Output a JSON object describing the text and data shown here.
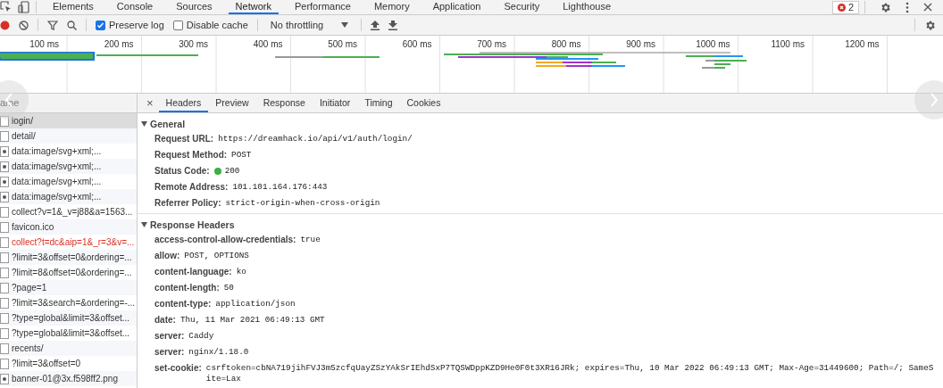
{
  "top_tabs": [
    {
      "label": "Elements",
      "selected": false
    },
    {
      "label": "Console",
      "selected": false
    },
    {
      "label": "Sources",
      "selected": false
    },
    {
      "label": "Network",
      "selected": true
    },
    {
      "label": "Performance",
      "selected": false
    },
    {
      "label": "Memory",
      "selected": false
    },
    {
      "label": "Application",
      "selected": false
    },
    {
      "label": "Security",
      "selected": false
    },
    {
      "label": "Lighthouse",
      "selected": false
    }
  ],
  "error_badge": "2",
  "toolbar": {
    "recording": true,
    "preserve_log": {
      "label": "Preserve log",
      "checked": true
    },
    "disable_cache": {
      "label": "Disable cache",
      "checked": false
    },
    "throttling": "No throttling"
  },
  "timeline": {
    "ticks": [
      "100 ms",
      "200 ms",
      "300 ms",
      "400 ms",
      "500 ms",
      "600 ms",
      "700 ms",
      "800 ms",
      "900 ms",
      "1000 ms",
      "1100 ms",
      "1200 ms"
    ]
  },
  "requests": {
    "column": "ame",
    "rows": [
      {
        "name": "login/",
        "selected": true,
        "error": false,
        "kind": "document"
      },
      {
        "name": "detail/",
        "selected": false,
        "error": false,
        "kind": "document"
      },
      {
        "name": "data:image/svg+xml;...",
        "selected": false,
        "error": false,
        "kind": "image"
      },
      {
        "name": "data:image/svg+xml;...",
        "selected": false,
        "error": false,
        "kind": "image"
      },
      {
        "name": "data:image/svg+xml;...",
        "selected": false,
        "error": false,
        "kind": "image"
      },
      {
        "name": "data:image/svg+xml;...",
        "selected": false,
        "error": false,
        "kind": "image"
      },
      {
        "name": "collect?v=1&_v=j88&a=1563...",
        "selected": false,
        "error": false,
        "kind": "document"
      },
      {
        "name": "favicon.ico",
        "selected": false,
        "error": false,
        "kind": "document"
      },
      {
        "name": "collect?t=dc&aip=1&_r=3&v=...",
        "selected": false,
        "error": true,
        "kind": "document"
      },
      {
        "name": "?limit=3&offset=0&ordering=...",
        "selected": false,
        "error": false,
        "kind": "document"
      },
      {
        "name": "?limit=8&offset=0&ordering=...",
        "selected": false,
        "error": false,
        "kind": "document"
      },
      {
        "name": "?page=1",
        "selected": false,
        "error": false,
        "kind": "document"
      },
      {
        "name": "?limit=3&search=&ordering=-...",
        "selected": false,
        "error": false,
        "kind": "document"
      },
      {
        "name": "?type=global&limit=3&offset...",
        "selected": false,
        "error": false,
        "kind": "document"
      },
      {
        "name": "?type=global&limit=3&offset...",
        "selected": false,
        "error": false,
        "kind": "document"
      },
      {
        "name": "recents/",
        "selected": false,
        "error": false,
        "kind": "document"
      },
      {
        "name": "?limit=3&offset=0",
        "selected": false,
        "error": false,
        "kind": "document"
      },
      {
        "name": "banner-01@3x.f598ff2.png",
        "selected": false,
        "error": false,
        "kind": "image"
      }
    ]
  },
  "close_symbol": "×",
  "detail_tabs": [
    {
      "label": "Headers",
      "selected": true
    },
    {
      "label": "Preview",
      "selected": false
    },
    {
      "label": "Response",
      "selected": false
    },
    {
      "label": "Initiator",
      "selected": false
    },
    {
      "label": "Timing",
      "selected": false
    },
    {
      "label": "Cookies",
      "selected": false
    }
  ],
  "sections": [
    {
      "title": "General",
      "expanded": true,
      "rows": [
        {
          "key": "Request URL:",
          "value": "https://dreamhack.io/api/v1/auth/login/"
        },
        {
          "key": "Request Method:",
          "value": "POST"
        },
        {
          "key": "Status Code:",
          "value": "200",
          "color": "#3cb043"
        },
        {
          "key": "Remote Address:",
          "value": "101.101.164.176:443"
        },
        {
          "key": "Referrer Policy:",
          "value": "strict-origin-when-cross-origin"
        }
      ]
    },
    {
      "title": "Response Headers",
      "expanded": true,
      "rows": [
        {
          "key": "access-control-allow-credentials:",
          "value": "true"
        },
        {
          "key": "allow:",
          "value": "POST, OPTIONS"
        },
        {
          "key": "content-language:",
          "value": "ko"
        },
        {
          "key": "content-length:",
          "value": "50"
        },
        {
          "key": "content-type:",
          "value": "application/json"
        },
        {
          "key": "date:",
          "value": "Thu, 11 Mar 2021 06:49:13 GMT"
        },
        {
          "key": "server:",
          "value": "Caddy"
        },
        {
          "key": "server:",
          "value": "nginx/1.18.0"
        },
        {
          "key": "set-cookie:",
          "value": "csrftoken=cbNA719jihFVJ3m5zcfqUayZSzYAkSrIEhdSxP7TQSWDppKZD9He0F0t3XR16JRk; expires=Thu, 10 Mar 2022 06:49:13 GMT; Max-Age=31449600; Path=/; SameSite=Lax"
        }
      ]
    }
  ]
}
